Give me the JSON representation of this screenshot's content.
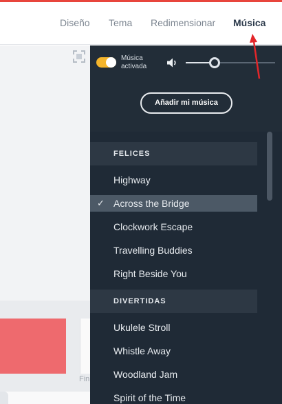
{
  "nav": {
    "tabs": [
      {
        "label": "Diseño",
        "active": false
      },
      {
        "label": "Tema",
        "active": false
      },
      {
        "label": "Redimensionar",
        "active": false
      },
      {
        "label": "Música",
        "active": true
      }
    ]
  },
  "canvas": {
    "partial_caption": "Fin"
  },
  "music_panel": {
    "toggle_label": "Música activada",
    "toggle_on": true,
    "volume_fraction": 0.32,
    "add_music_label": "Añadir mi música",
    "sections": [
      {
        "title": "FELICES",
        "tracks": [
          {
            "name": "Highway",
            "selected": false
          },
          {
            "name": "Across the Bridge",
            "selected": true
          },
          {
            "name": "Clockwork Escape",
            "selected": false
          },
          {
            "name": "Travelling Buddies",
            "selected": false
          },
          {
            "name": "Right Beside You",
            "selected": false
          }
        ]
      },
      {
        "title": "DIVERTIDAS",
        "tracks": [
          {
            "name": "Ukulele Stroll",
            "selected": false
          },
          {
            "name": "Whistle Away",
            "selected": false
          },
          {
            "name": "Woodland Jam",
            "selected": false
          },
          {
            "name": "Spirit of the Time",
            "selected": false
          }
        ]
      }
    ]
  },
  "colors": {
    "accent": "#f4b52c",
    "top_accent": "#e8453c",
    "panel_bg": "#1f2a36",
    "selected_row": "#4c5966",
    "annotation_arrow": "#e3262a"
  },
  "icons": [
    "expand-icon",
    "speaker-icon",
    "checkmark-icon"
  ]
}
